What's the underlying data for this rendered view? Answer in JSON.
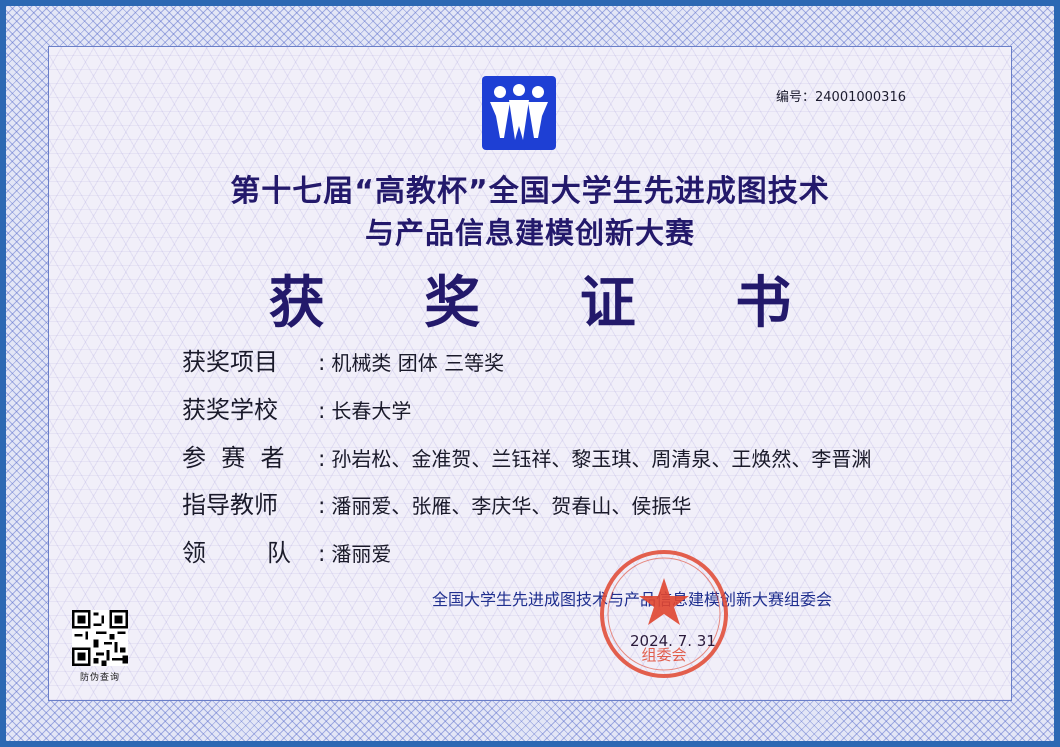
{
  "certificate": {
    "serial": "编号：24001000316",
    "title_line1": "第十七届“高教杯”全国大学生先进成图技术",
    "title_line2": "与产品信息建模创新大赛",
    "heading": "获 奖 证 书",
    "fields": [
      {
        "label": "获奖项目",
        "value": "机械类 团体 三等奖"
      },
      {
        "label": "获奖学校",
        "value": "长春大学"
      },
      {
        "label": "参  赛  者",
        "value": "孙岩松、金准贺、兰钰祥、黎玉琪、周清泉、王焕然、李晋渊"
      },
      {
        "label": "指导教师",
        "value": "潘丽爱、张雁、李庆华、贺春山、侯振华"
      },
      {
        "label": "领        队",
        "value": "潘丽爱"
      }
    ],
    "colon": ":",
    "issuer": "全国大学生先进成图技术与产品信息建模创新大赛组委会",
    "date": "2024. 7. 31",
    "seal_text": "组委会",
    "qr_label": "防伪查询"
  },
  "colors": {
    "title": "#23196b",
    "border": "#2c68b3",
    "seal": "#e0452f",
    "logo": "#1e3fd4"
  }
}
